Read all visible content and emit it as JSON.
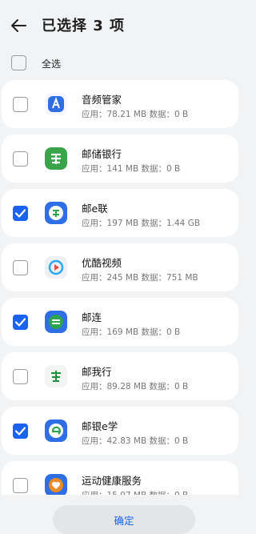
{
  "header": {
    "title": "已选择 3 项"
  },
  "select_all": {
    "label": "全选",
    "checked": false
  },
  "apps": [
    {
      "name": "音频管家",
      "info": "应用：78.21 MB 数据：0 B",
      "checked": false,
      "icon": "audio-manager-icon",
      "color": "#2f6fe6"
    },
    {
      "name": "邮储银行",
      "info": "应用：141 MB 数据：0 B",
      "checked": false,
      "icon": "postal-bank-icon",
      "color": "#3aa44b"
    },
    {
      "name": "邮e联",
      "info": "应用：197 MB 数据：1.44 GB",
      "checked": true,
      "icon": "post-elian-icon",
      "color": "#2f6fe6"
    },
    {
      "name": "优酷视频",
      "info": "应用：245 MB 数据：751 MB",
      "checked": false,
      "icon": "youku-icon",
      "color": "#e84a4a"
    },
    {
      "name": "邮连",
      "info": "应用：169 MB 数据：0 B",
      "checked": true,
      "icon": "youlian-icon",
      "color": "#2da44e"
    },
    {
      "name": "邮我行",
      "info": "应用：89.28 MB 数据：0 B",
      "checked": false,
      "icon": "youwoxing-icon",
      "color": "#1e8f3a"
    },
    {
      "name": "邮银e学",
      "info": "应用：42.83 MB 数据：0 B",
      "checked": true,
      "icon": "youyin-exue-icon",
      "color": "#2f6fe6"
    },
    {
      "name": "运动健康服务",
      "info": "应用：15.97 MB 数据：0 B",
      "checked": false,
      "icon": "sports-health-icon",
      "color": "#f08a24"
    }
  ],
  "footer": {
    "confirm_label": "确定"
  },
  "colors": {
    "accent": "#1a62f0",
    "background": "#f1f3f5",
    "card": "#ffffff"
  }
}
